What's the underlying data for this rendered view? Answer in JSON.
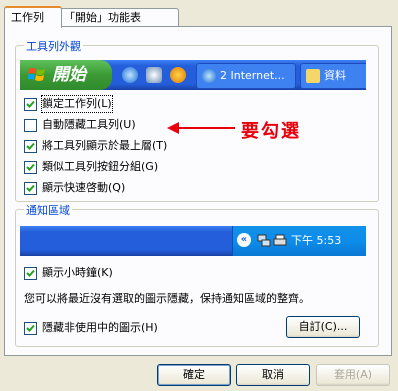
{
  "tabs": [
    {
      "label": "工作列",
      "active": true
    },
    {
      "label": "「開始」功能表",
      "active": false
    }
  ],
  "appearance_group": {
    "title": "工具列外觀",
    "taskbar_preview": {
      "start_label": "開始",
      "task_items": [
        "2 Internet...",
        "資料"
      ]
    },
    "options": [
      {
        "label": "鎖定工作列(L)",
        "checked": true
      },
      {
        "label": "自動隱藏工具列(U)",
        "checked": false
      },
      {
        "label": "將工具列顯示於最上層(T)",
        "checked": true
      },
      {
        "label": "類似工具列按鈕分組(G)",
        "checked": true
      },
      {
        "label": "顯示快速啓動(Q)",
        "checked": true
      }
    ],
    "annotation": "要勾選"
  },
  "notification_group": {
    "title": "通知區域",
    "tray_preview": {
      "clock": "下午 5:53"
    },
    "show_clock": {
      "label": "顯示小時鐘(K)",
      "checked": true
    },
    "description": "您可以將最近沒有選取的圖示隱藏，保持通知區域的整齊。",
    "hide_inactive": {
      "label": "隱藏非使用中的圖示(H)",
      "checked": true
    },
    "customize_label": "自訂(C)..."
  },
  "buttons": {
    "ok": "確定",
    "cancel": "取消",
    "apply": "套用(A)"
  },
  "colors": {
    "accent_tab": "#e68b2c",
    "group_title": "#0046d5",
    "annotation": "#e8000b",
    "taskbar": "#245edb",
    "start_button": "#3c9a34"
  }
}
